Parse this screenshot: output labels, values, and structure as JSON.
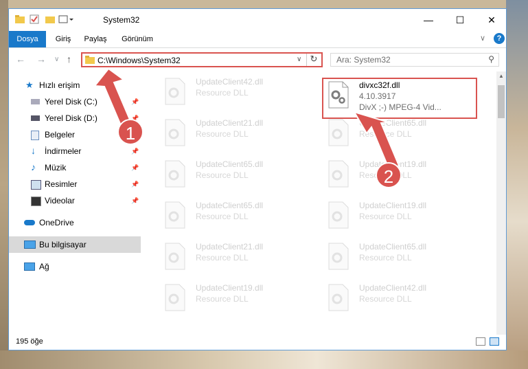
{
  "window": {
    "title": "System32"
  },
  "ribbon": {
    "tabs": [
      "Dosya",
      "Giriş",
      "Paylaş",
      "Görünüm"
    ]
  },
  "nav": {
    "address": "C:\\Windows\\System32",
    "search_placeholder": "Ara: System32"
  },
  "sidebar": {
    "items": [
      {
        "label": "Hızlı erişim",
        "icon": "star-icon"
      },
      {
        "label": "Yerel Disk (C:)",
        "icon": "drive-icon",
        "pinned": true
      },
      {
        "label": "Yerel Disk (D:)",
        "icon": "drive-icon",
        "pinned": true
      },
      {
        "label": "Belgeler",
        "icon": "documents-icon",
        "pinned": true
      },
      {
        "label": "İndirmeler",
        "icon": "download-icon",
        "pinned": true
      },
      {
        "label": "Müzik",
        "icon": "music-icon",
        "pinned": true
      },
      {
        "label": "Resimler",
        "icon": "pictures-icon",
        "pinned": true
      },
      {
        "label": "Videolar",
        "icon": "video-icon",
        "pinned": true
      },
      {
        "label": "OneDrive",
        "icon": "cloud-icon"
      },
      {
        "label": "Bu bilgisayar",
        "icon": "computer-icon"
      },
      {
        "label": "Ağ",
        "icon": "network-icon"
      }
    ]
  },
  "files": {
    "col1": [
      {
        "name": "UpdateClient42.dll",
        "desc": "Resource DLL"
      },
      {
        "name": "UpdateClient21.dll",
        "desc": "Resource DLL"
      },
      {
        "name": "UpdateClient65.dll",
        "desc": "Resource DLL"
      },
      {
        "name": "UpdateClient65.dll",
        "desc": "Resource DLL"
      },
      {
        "name": "UpdateClient21.dll",
        "desc": "Resource DLL"
      },
      {
        "name": "UpdateClient19.dll",
        "desc": "Resource DLL"
      }
    ],
    "col2": [
      {
        "name": "divxc32f.dll",
        "version": "4.10.3917",
        "desc": "DivX ;-) MPEG-4 Vid..."
      },
      {
        "name": "UpdateClient65.dll",
        "desc": "Resource DLL"
      },
      {
        "name": "UpdateClient19.dll",
        "desc": "Resource DLL"
      },
      {
        "name": "UpdateClient19.dll",
        "desc": "Resource DLL"
      },
      {
        "name": "UpdateClient65.dll",
        "desc": "Resource DLL"
      },
      {
        "name": "UpdateClient42.dll",
        "desc": "Resource DLL"
      }
    ]
  },
  "status": {
    "item_count": "195 öğe"
  },
  "annotations": {
    "step1": "1",
    "step2": "2"
  },
  "colors": {
    "accent": "#1979ca",
    "highlight": "#d9534f"
  }
}
